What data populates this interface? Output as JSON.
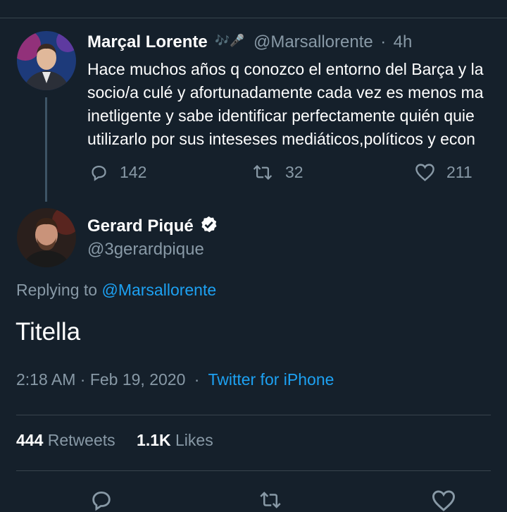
{
  "parent_tweet": {
    "author_name": "Marçal Lorente",
    "author_emoji": "🎶🎤",
    "handle": "@Marsallorente",
    "separator": "·",
    "time_ago": "4h",
    "text_lines": [
      "Hace muchos años q conozco el entorno del Barça y la",
      "socio/a culé y afortunadamente cada vez es menos ma",
      "inetligente y sabe identificar perfectamente quién quie",
      "utilizarlo por sus inteseses mediáticos,políticos y econ"
    ],
    "reply_count": "142",
    "retweet_count": "32",
    "like_count": "211"
  },
  "main_tweet": {
    "author_name": "Gerard Piqué",
    "handle": "@3gerardpique",
    "replying_prefix": "Replying to",
    "replying_handle": "@Marsallorente",
    "text": "Titella",
    "timestamp": "2:18 AM · Feb 19, 2020",
    "separator": "·",
    "source": "Twitter for iPhone",
    "retweets_count": "444",
    "retweets_label": "Retweets",
    "likes_count": "1.1K",
    "likes_label": "Likes"
  },
  "icons": [
    "reply-icon",
    "retweet-icon",
    "like-icon",
    "verified-badge-icon"
  ],
  "colors": {
    "background": "#15202b",
    "text": "#ffffff",
    "muted": "#8899a6",
    "link": "#1da1f2",
    "divider": "#38444d"
  }
}
